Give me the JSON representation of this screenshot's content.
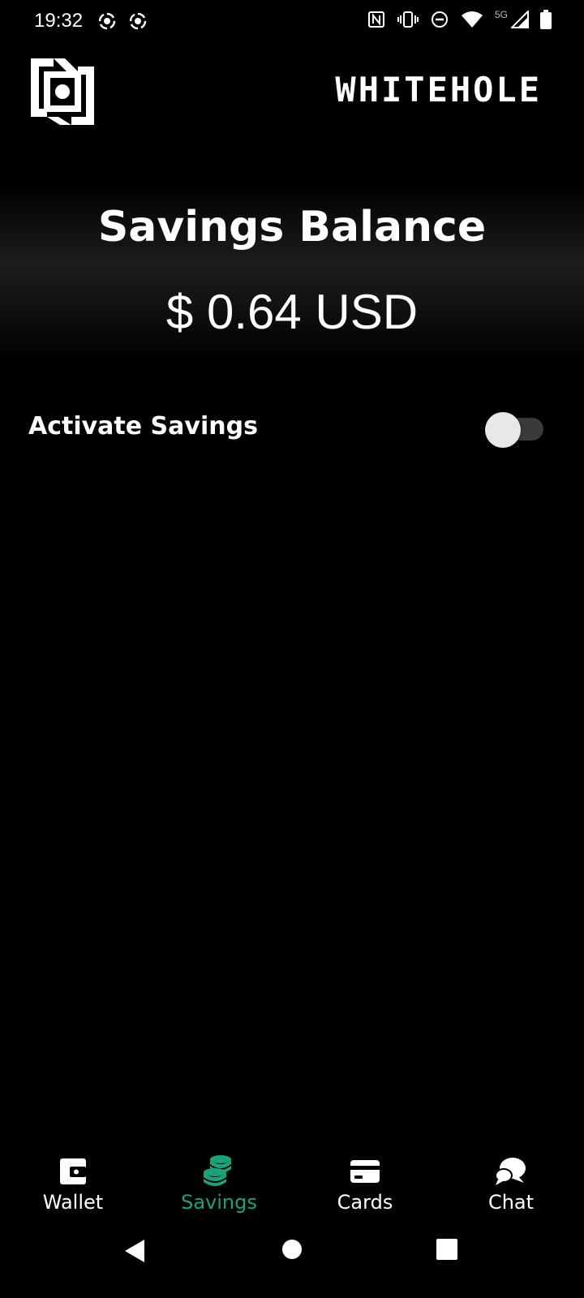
{
  "status_bar": {
    "time": "19:32",
    "network_label": "5G"
  },
  "header": {
    "logo_icon": "whitehole-logo-icon",
    "brand_name": "WHITEHOLE"
  },
  "balance": {
    "title": "Savings Balance",
    "amount": "$ 0.64 USD"
  },
  "savings_toggle": {
    "label": "Activate Savings",
    "enabled": false
  },
  "bottom_nav": {
    "items": [
      {
        "label": "Wallet",
        "icon": "wallet-icon",
        "active": false
      },
      {
        "label": "Savings",
        "icon": "coins-stack-icon",
        "active": true
      },
      {
        "label": "Cards",
        "icon": "card-icon",
        "active": false
      },
      {
        "label": "Chat",
        "icon": "chat-bubbles-icon",
        "active": false
      }
    ]
  },
  "colors": {
    "background": "#000000",
    "text": "#ffffff",
    "accent": "#1aa37a",
    "toggle_track": "#3a3a3a",
    "toggle_thumb": "#e8e8e8"
  }
}
